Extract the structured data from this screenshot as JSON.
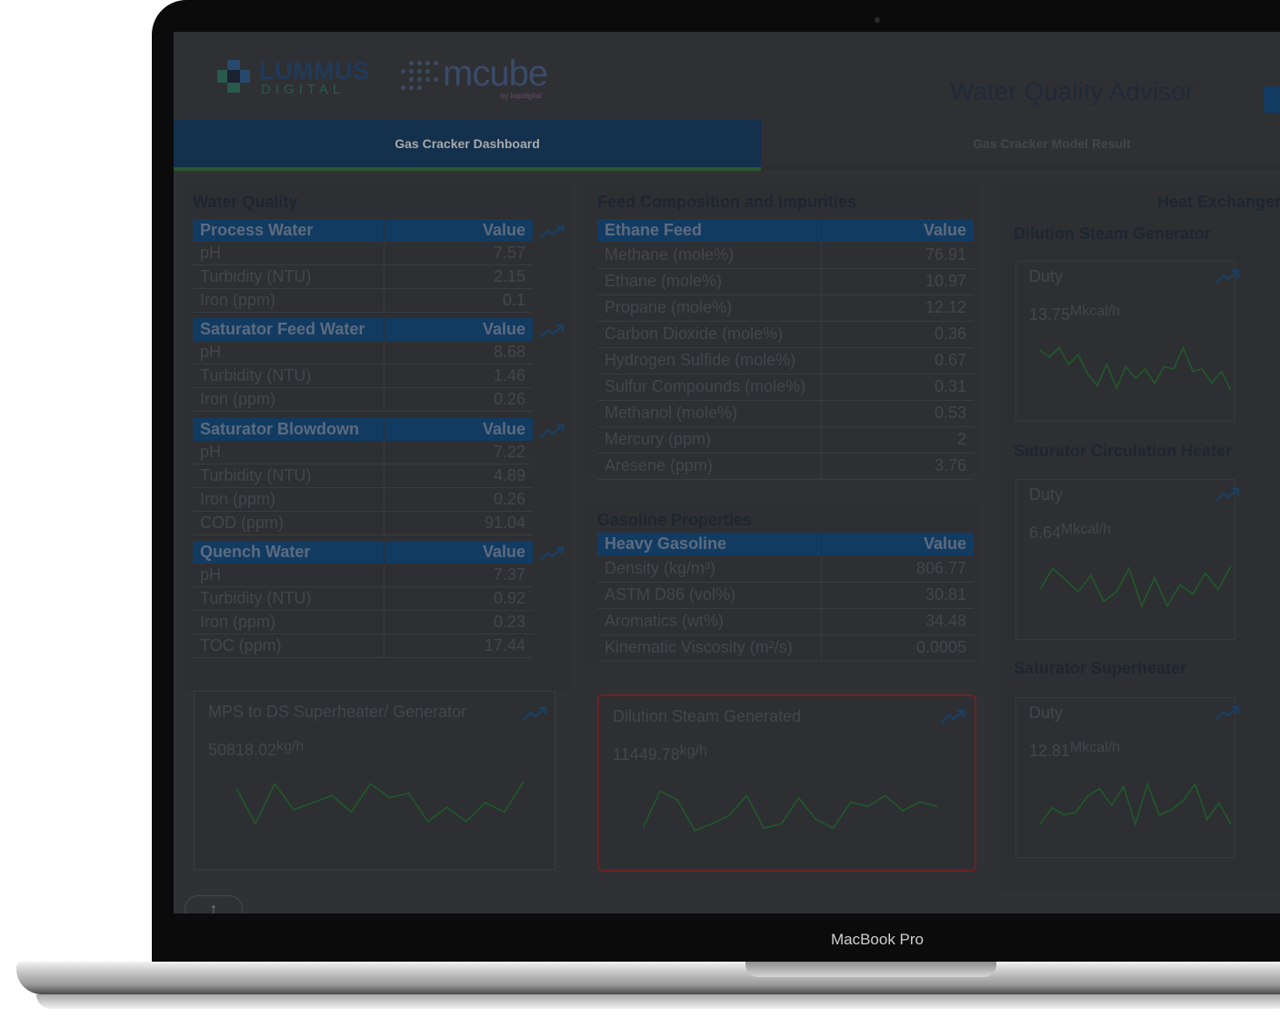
{
  "device": {
    "brand_label": "MacBook Pro"
  },
  "header": {
    "logo_primary": "LUMMUS",
    "logo_primary_sub": "DIGITAL",
    "logo_secondary": "mcube",
    "logo_secondary_sub": "by kapdigital",
    "app_title": "Water Quality Advisor"
  },
  "tabs": [
    {
      "label": "Gas Cracker Dashboard",
      "active": true
    },
    {
      "label": "Gas Cracker Model Result",
      "active": false
    }
  ],
  "water_quality": {
    "title": "Water Quality",
    "value_header": "Value",
    "tables": [
      {
        "name": "Process Water",
        "rows": [
          [
            "pH",
            "7.57"
          ],
          [
            "Turbidity (NTU)",
            "2.15"
          ],
          [
            "Iron (ppm)",
            "0.1"
          ]
        ]
      },
      {
        "name": "Saturator Feed Water",
        "rows": [
          [
            "pH",
            "8.68"
          ],
          [
            "Turbidity (NTU)",
            "1.46"
          ],
          [
            "Iron (ppm)",
            "0.26"
          ]
        ]
      },
      {
        "name": "Saturator Blowdown",
        "rows": [
          [
            "pH",
            "7.22"
          ],
          [
            "Turbidity (NTU)",
            "4.89"
          ],
          [
            "Iron (ppm)",
            "0.26"
          ],
          [
            "COD (ppm)",
            "91.04"
          ]
        ]
      },
      {
        "name": "Quench Water",
        "rows": [
          [
            "pH",
            "7.37"
          ],
          [
            "Turbidity (NTU)",
            "0.92"
          ],
          [
            "Iron (ppm)",
            "0.23"
          ],
          [
            "TOC (ppm)",
            "17.44"
          ]
        ]
      }
    ]
  },
  "feed": {
    "title": "Feed Composition and Impurities",
    "table_name": "Ethane Feed",
    "value_header": "Value",
    "rows": [
      [
        "Methane (mole%)",
        "76.91"
      ],
      [
        "Ethane (mole%)",
        "10.97"
      ],
      [
        "Propane (mole%)",
        "12.12"
      ],
      [
        "Carbon Dioxide (mole%)",
        "0.36"
      ],
      [
        "Hydrogen Sulfide (mole%)",
        "0.67"
      ],
      [
        "Sulfur Compounds (mole%)",
        "0.31"
      ],
      [
        "Methanol (mole%)",
        "0.53"
      ],
      [
        "Mercury (ppm)",
        "2"
      ],
      [
        "Aresene (ppm)",
        "3.76"
      ]
    ]
  },
  "gasoline": {
    "title": "Gasoline Properties",
    "table_name": "Heavy Gasoline",
    "value_header": "Value",
    "rows": [
      [
        "Density (kg/m³)",
        "806.77"
      ],
      [
        "ASTM D86 (vol%)",
        "30.81"
      ],
      [
        "Aromatics (wt%)",
        "34.48"
      ],
      [
        "Kinematic Viscosity (m²/s)",
        "0.0005"
      ]
    ]
  },
  "kpi_cards": [
    {
      "label": "MPS to DS Superheater/ Generator",
      "value": "50818.02",
      "unit": "kg/h",
      "highlight": false,
      "spark": [
        0.8,
        0.05,
        0.9,
        0.35,
        0.5,
        0.65,
        0.3,
        0.9,
        0.6,
        0.7,
        0.1,
        0.4,
        0.1,
        0.5,
        0.3,
        0.95
      ]
    },
    {
      "label": "Dilution Steam Generated",
      "value": "11449.78",
      "unit": "kg/h",
      "highlight": false,
      "spark": [
        0.1,
        0.95,
        0.75,
        0.05,
        0.2,
        0.4,
        0.85,
        0.1,
        0.2,
        0.8,
        0.3,
        0.1,
        0.7,
        0.6,
        0.85,
        0.5,
        0.7,
        0.6
      ]
    }
  ],
  "heat_exchanger": {
    "title": "Heat Exchanger",
    "groups": [
      {
        "name": "Dilution Steam Generator",
        "metric": "Duty",
        "value": "13.75",
        "unit": "Mkcal/h",
        "spark": [
          0.9,
          0.75,
          0.95,
          0.6,
          0.8,
          0.4,
          0.15,
          0.6,
          0.1,
          0.55,
          0.3,
          0.5,
          0.2,
          0.55,
          0.5,
          0.95,
          0.45,
          0.5,
          0.2,
          0.45,
          0.05
        ]
      },
      {
        "name": "Saturator Circulation Heater",
        "metric": "Duty",
        "value": "6.64",
        "unit": "Mkcal/h",
        "spark": [
          0.45,
          0.9,
          0.65,
          0.4,
          0.75,
          0.2,
          0.4,
          0.9,
          0.1,
          0.7,
          0.1,
          0.55,
          0.35,
          0.8,
          0.45,
          0.95
        ]
      },
      {
        "name": "Saturator Superheater",
        "metric": "Duty",
        "value": "12.81",
        "unit": "Mkcal/h",
        "spark": [
          0.1,
          0.45,
          0.3,
          0.35,
          0.7,
          0.85,
          0.5,
          0.9,
          0.1,
          0.95,
          0.3,
          0.4,
          0.6,
          0.95,
          0.2,
          0.55,
          0.1
        ]
      }
    ]
  },
  "scroll_up_label": "↑"
}
